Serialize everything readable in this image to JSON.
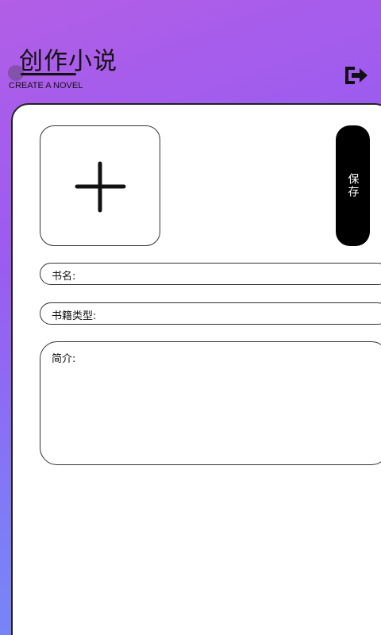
{
  "header": {
    "title": "创作小说",
    "subtitle": "CREATE A NOVEL",
    "exit_icon": "exit-icon"
  },
  "cover": {
    "icon": "plus-icon"
  },
  "save_button": {
    "label": "保存"
  },
  "form": {
    "book_name_label": "书名:",
    "book_type_label": "书籍类型:",
    "intro_label": "简介:"
  }
}
